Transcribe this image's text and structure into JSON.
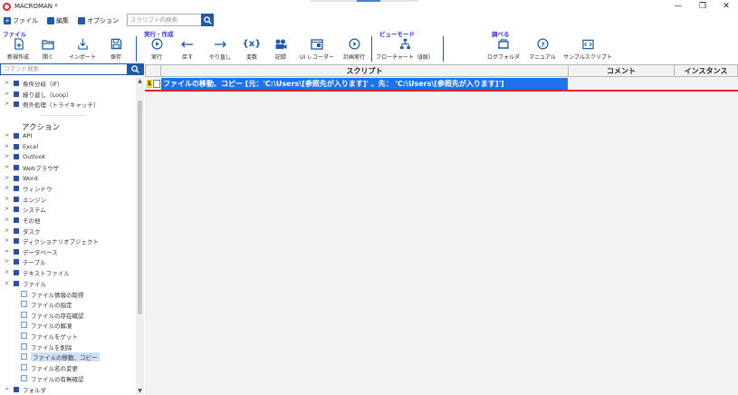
{
  "window": {
    "title": "MACROMAN *",
    "controls": [
      "—",
      "❐",
      "✕"
    ]
  },
  "menu": {
    "items": [
      "ファイル",
      "編集",
      "オプション"
    ],
    "search_placeholder": "スクリプト内検索"
  },
  "ribbon": {
    "groups": [
      "ファイル",
      "実行・作成",
      "ビューモード",
      "調べる"
    ],
    "buttons": [
      "新規作成",
      "開く",
      "インポート",
      "保存",
      "実行",
      "戻す",
      "やり直し",
      "変数",
      "記録",
      "UI レコーダー",
      "計画実行",
      "フローチャート（β版）",
      "ログフォルダ",
      "マニュアル",
      "サンプルスクリプト"
    ]
  },
  "left_panel": {
    "search_placeholder": "コマンド検索",
    "tree_top": [
      "条件分岐（IF）",
      "繰り返し（Loop）",
      "例外処理（トライキャッチ）"
    ],
    "action_heading": "アクション",
    "actions": [
      "API",
      "Excel",
      "Outlook",
      "Webブラウザ",
      "Word",
      "ウィンドウ",
      "エンジン",
      "システム",
      "その他",
      "タスク",
      "ディクショナリオブジェクト",
      "データベース",
      "テーブル",
      "テキストファイル",
      "ファイル"
    ],
    "file_children": [
      "ファイル情報の取得",
      "ファイルの指定",
      "ファイルの存在確認",
      "ファイルの解凍",
      "ファイルをゲット",
      "ファイルを削除",
      "ファイルの移動、コピー",
      "ファイル名の変更",
      "ファイルの有無確認"
    ],
    "selected_child_index": 6,
    "last_item": "フォルダ"
  },
  "grid": {
    "columns": [
      "スクリプト",
      "コメント",
      "インスタンス"
    ],
    "rows": [
      {
        "num": "1",
        "script": "ファイルの移動、コピー [元：'C:\\Users\\[参照先が入ります]' 、先： 'C:\\Users\\[参照先が入ります]']"
      }
    ]
  },
  "colors": {
    "accent": "#1f5aa6",
    "group_label": "#3a2ed0",
    "selected_row": "#1e74e6",
    "error_line": "#e0242b",
    "row_num_bg": "#f5d400"
  },
  "icons": [
    "new-file-icon",
    "open-folder-icon",
    "import-icon",
    "save-icon",
    "play-icon",
    "undo-icon",
    "redo-icon",
    "variable-icon",
    "record-icon",
    "ui-recorder-icon",
    "schedule-icon",
    "flowchart-icon",
    "log-folder-icon",
    "help-icon",
    "sample-script-icon"
  ]
}
